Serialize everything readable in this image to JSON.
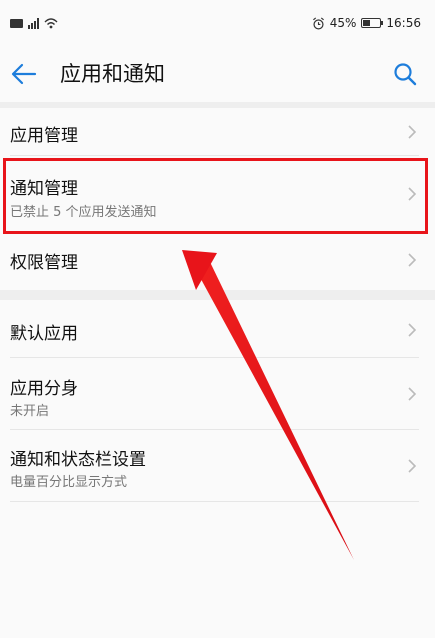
{
  "status_bar": {
    "network": "⁴⁶",
    "battery_percent": "45%",
    "time": "16:56",
    "battery_level": 0.45
  },
  "header": {
    "title": "应用和通知"
  },
  "items": [
    {
      "title": "应用管理",
      "subtitle": ""
    },
    {
      "title": "通知管理",
      "subtitle": "已禁止 5 个应用发送通知"
    },
    {
      "title": "权限管理",
      "subtitle": ""
    },
    {
      "title": "默认应用",
      "subtitle": ""
    },
    {
      "title": "应用分身",
      "subtitle": "未开启"
    },
    {
      "title": "通知和状态栏设置",
      "subtitle": "电量百分比显示方式"
    }
  ],
  "colors": {
    "accent": "#1d7ddb",
    "annotation": "#e8141a"
  }
}
